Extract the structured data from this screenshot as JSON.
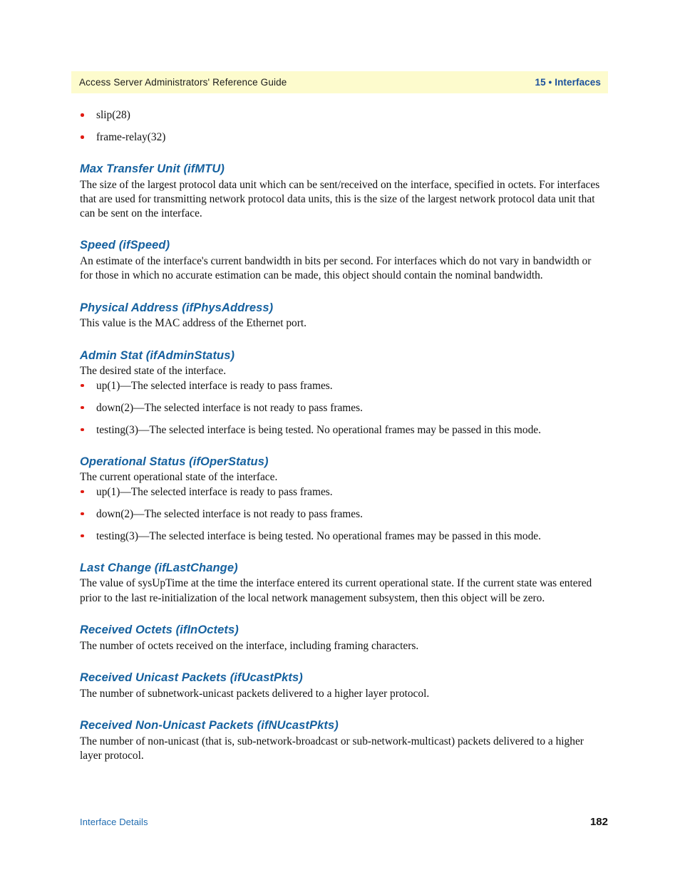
{
  "header": {
    "left_text": "Access Server Administrators' Reference Guide",
    "right_text": "15 • Interfaces",
    "band_color": "#fdfbcd",
    "right_text_color": "#1a4f9c"
  },
  "colors": {
    "heading_blue": "#15619f",
    "bullet_red": "#e01b12",
    "footer_blue": "#1f6bb0",
    "body_black": "#111111"
  },
  "top_bullets": [
    "slip(28)",
    "frame-relay(32)"
  ],
  "sections": [
    {
      "heading": "Max Transfer Unit (ifMTU)",
      "body": "The size of the largest protocol data unit which can be sent/received on the interface, specified in octets. For interfaces that are used for transmitting network protocol data units, this is the size of the largest network protocol data unit that can be sent on the interface."
    },
    {
      "heading": "Speed (ifSpeed)",
      "body": "An estimate of the interface's current bandwidth in bits per second. For interfaces which do not vary in bandwidth or for those in which no accurate estimation can be made, this object should contain the nominal bandwidth."
    },
    {
      "heading": "Physical Address (ifPhysAddress)",
      "body": "This value is the MAC address of the Ethernet port."
    },
    {
      "heading": "Admin Stat (ifAdminStatus)",
      "body": "The desired state of the interface.",
      "bullets": [
        "up(1)—The selected interface is ready to pass frames.",
        "down(2)—The selected interface is not ready to pass frames.",
        "testing(3)—The selected interface is being tested. No operational frames may be passed in this mode."
      ]
    },
    {
      "heading": "Operational Status (ifOperStatus)",
      "body": "The current operational state of the interface.",
      "bullets": [
        "up(1)—The selected interface is ready to pass frames.",
        "down(2)—The selected interface is not ready to pass frames.",
        "testing(3)—The selected interface is being tested. No operational frames may be passed in this mode."
      ]
    },
    {
      "heading": "Last Change (ifLastChange)",
      "body": "The value of sysUpTime at the time the interface entered its current operational state. If the current state was entered prior to the last re-initialization of the local network management subsystem, then this object will be zero."
    },
    {
      "heading": "Received Octets (ifInOctets)",
      "body": "The number of octets received on the interface, including framing characters."
    },
    {
      "heading": "Received Unicast Packets (ifUcastPkts)",
      "body": "The number of subnetwork-unicast packets delivered to a higher layer protocol."
    },
    {
      "heading": "Received Non-Unicast Packets (ifNUcastPkts)",
      "body": "The number of non-unicast (that is, sub-network-broadcast or sub-network-multicast) packets delivered to a higher layer protocol."
    }
  ],
  "footer": {
    "left_text": "Interface Details",
    "page_number": "182"
  }
}
